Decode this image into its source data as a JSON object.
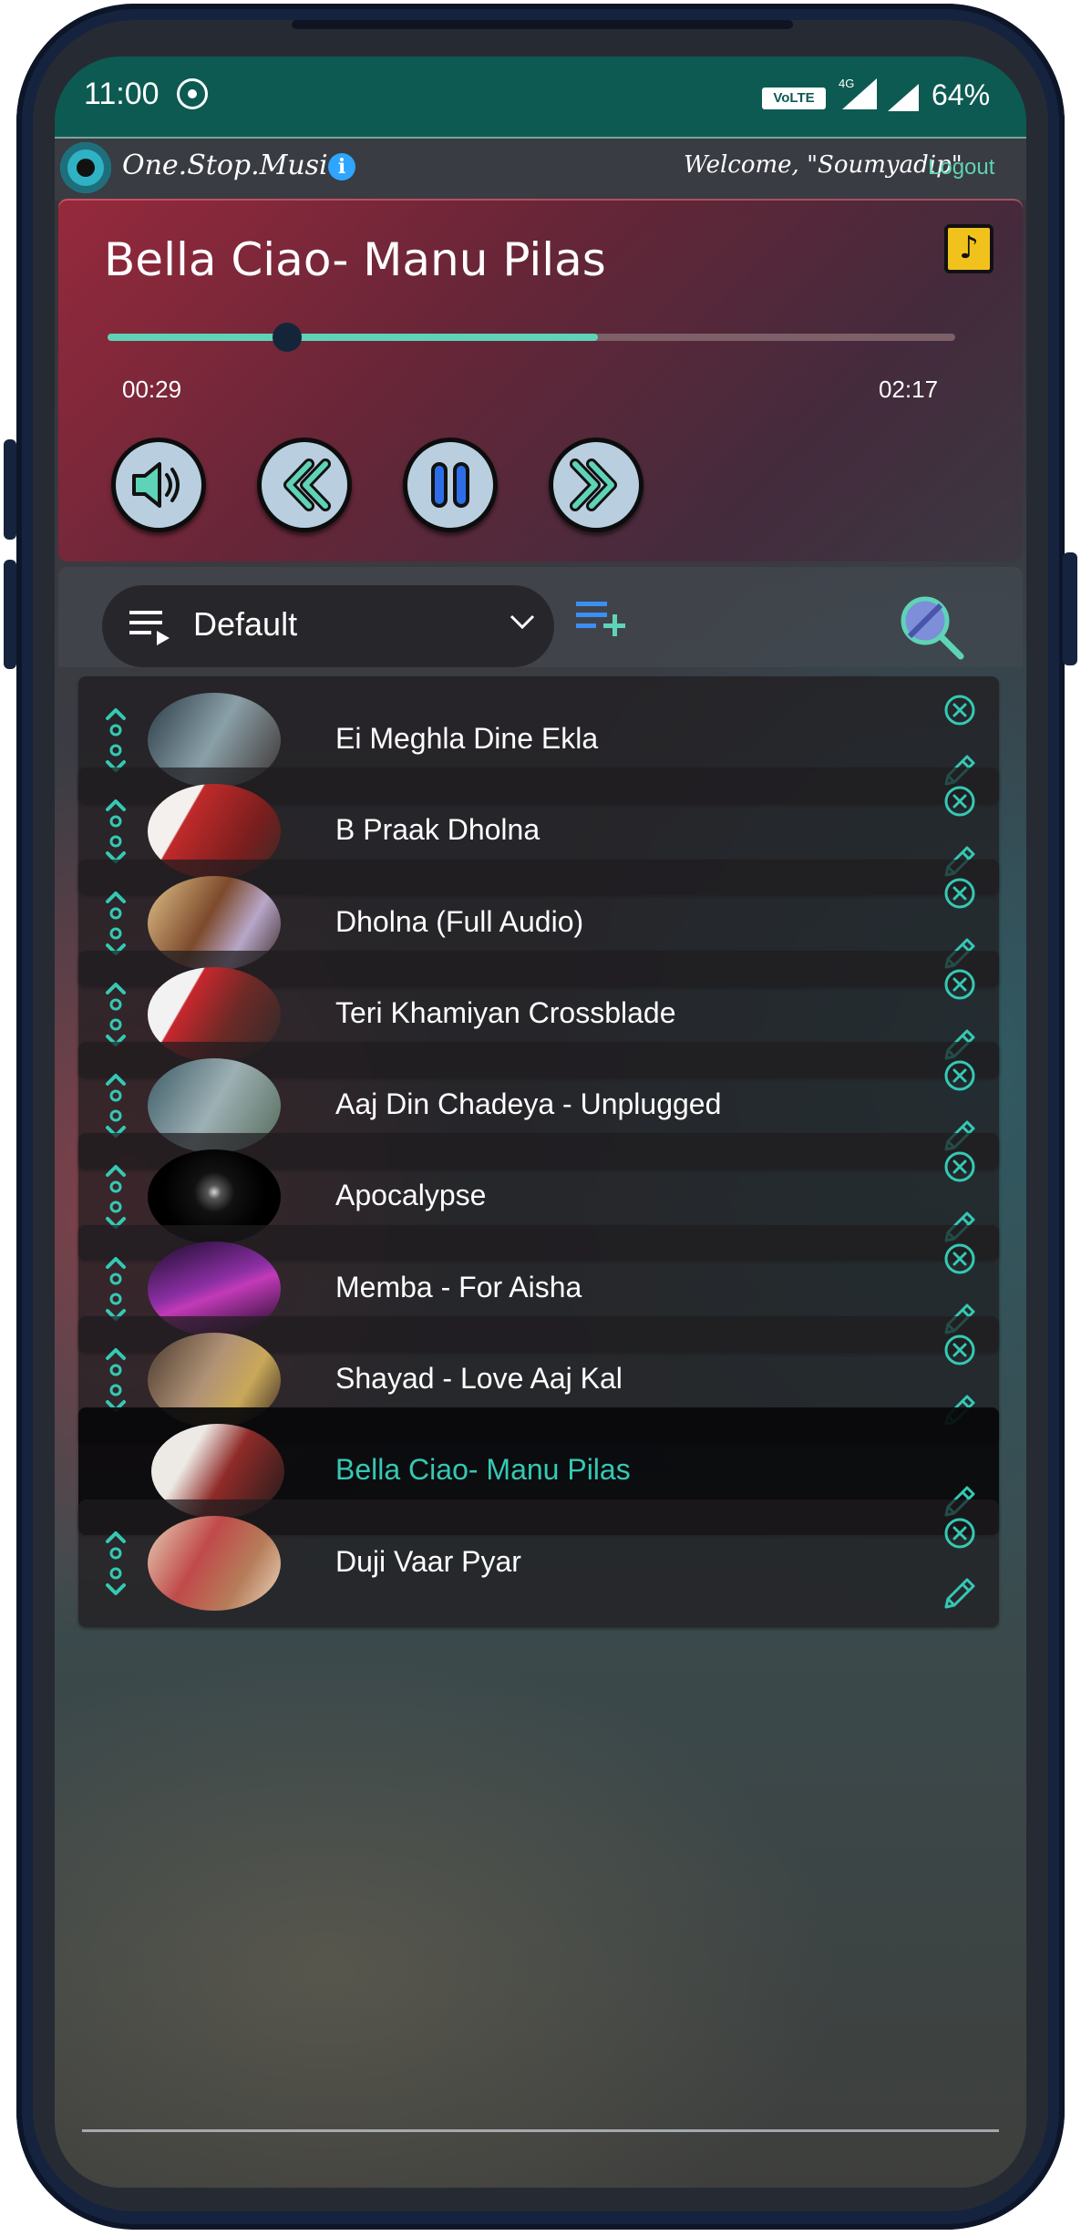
{
  "status_bar": {
    "time": "11:00",
    "volte_label": "VoLTE",
    "network_label": "4G",
    "battery": "64%"
  },
  "app_bar": {
    "title": "One.Stop.Music",
    "info_glyph": "i",
    "welcome": "Welcome, \"Soumyadip\"",
    "logout": "Logout"
  },
  "player": {
    "now_playing": "Bella Ciao- Manu Pilas",
    "elapsed": "00:29",
    "duration": "02:17",
    "playhead_fraction": 0.212,
    "buffered_fraction": 0.578,
    "accent_color": "#5fd3b7",
    "controls": [
      "volume-icon",
      "previous-icon",
      "pause-icon",
      "next-icon"
    ]
  },
  "playlist_toolbar": {
    "selected_playlist": "Default",
    "add_playlist_icon": "playlist-add-icon",
    "search_icon": "search-icon"
  },
  "tracks": [
    {
      "title": "Ei Meghla Dine Ekla",
      "active": false
    },
    {
      "title": "B Praak Dholna",
      "active": false
    },
    {
      "title": "Dholna (Full Audio)",
      "active": false
    },
    {
      "title": "Teri Khamiyan Crossblade",
      "active": false
    },
    {
      "title": "Aaj Din Chadeya - Unplugged",
      "active": false
    },
    {
      "title": "Apocalypse",
      "active": false
    },
    {
      "title": "Memba - For Aisha",
      "active": false
    },
    {
      "title": "Shayad - Love Aaj Kal",
      "active": false
    },
    {
      "title": "Bella Ciao- Manu Pilas",
      "active": true
    },
    {
      "title": "Duji Vaar Pyar",
      "active": false
    }
  ]
}
